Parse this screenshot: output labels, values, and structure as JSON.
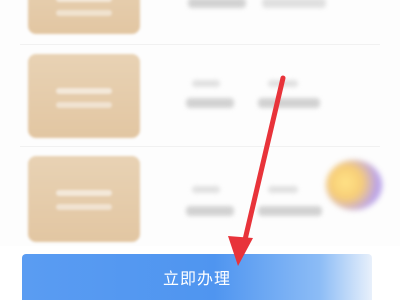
{
  "cta": {
    "label": "立即办理",
    "color": "#4f95f0"
  },
  "annotation": {
    "arrow_color": "#e8333a",
    "icon": "red-pointer-arrow"
  },
  "decor": {
    "thumbnail_color": "#e5cba8",
    "badge_icon": "promo-badge-icon"
  }
}
